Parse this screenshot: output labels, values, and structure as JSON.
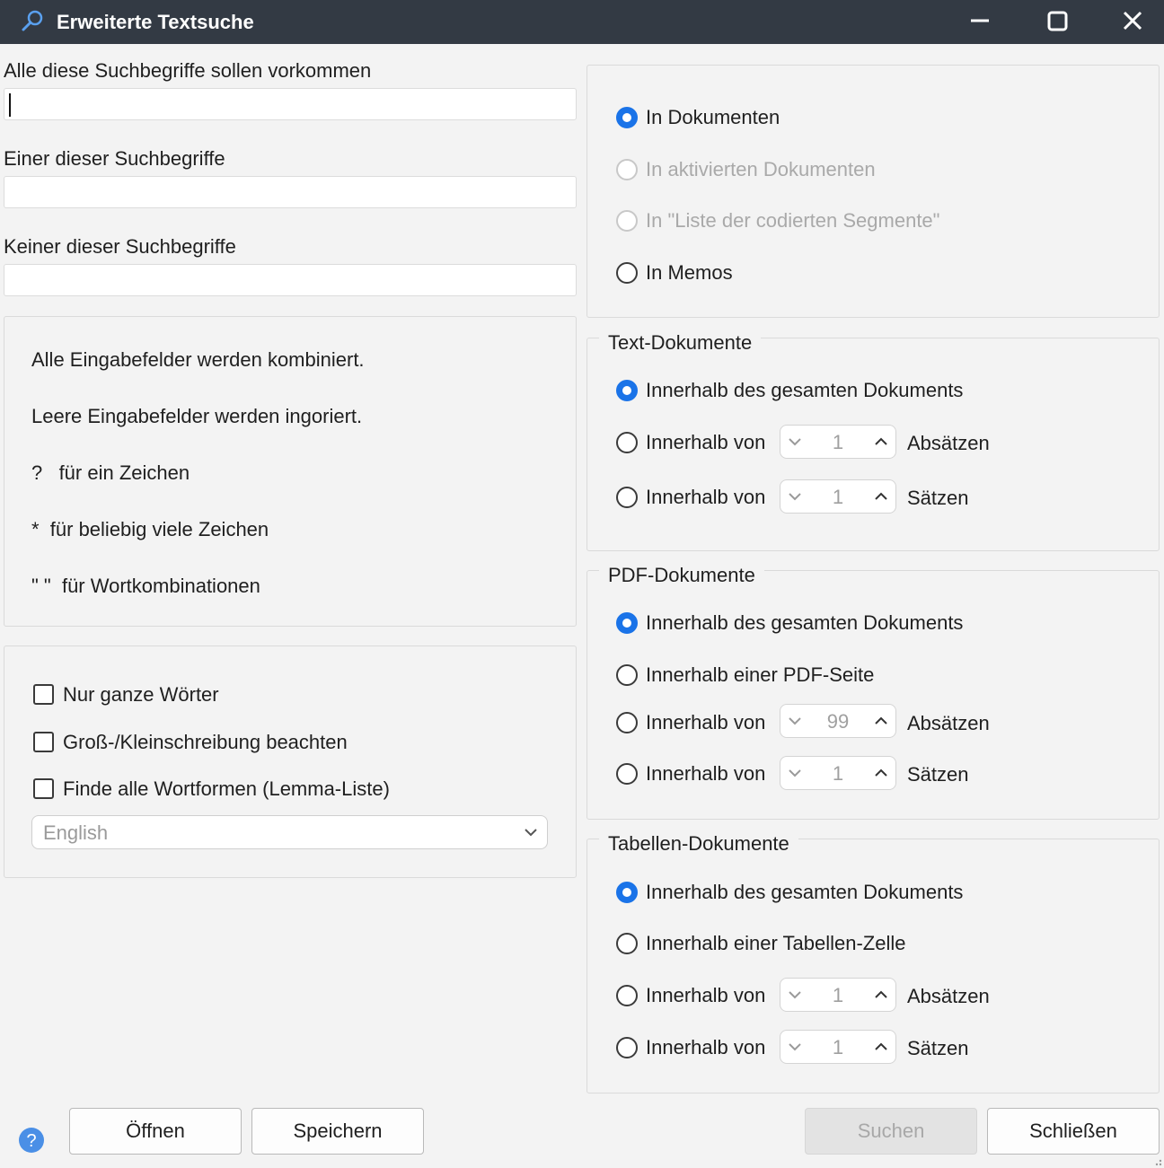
{
  "window": {
    "title": "Erweiterte Textsuche"
  },
  "colors": {
    "titlebar": "#333a44",
    "accent": "#1a73e8",
    "background": "#f3f3f3"
  },
  "fields": {
    "all_label": "Alle diese Suchbegriffe sollen vorkommen",
    "all_value": "",
    "any_label": "Einer dieser Suchbegriffe",
    "any_value": "",
    "none_label": "Keiner dieser Suchbegriffe",
    "none_value": ""
  },
  "hints": {
    "combined": "Alle Eingabefelder werden kombiniert.",
    "ignored": "Leere Eingabefelder werden ingoriert.",
    "single_char": "?   für ein Zeichen",
    "many_chars": "*  für beliebig viele Zeichen",
    "word_combo": "\" \"  für Wortkombinationen"
  },
  "options": {
    "whole_words": "Nur ganze Wörter",
    "case_sensitive": "Groß-/Kleinschreibung beachten",
    "lemma": "Finde alle Wortformen (Lemma-Liste)",
    "language": "English"
  },
  "scope": {
    "in_documents": "In Dokumenten",
    "in_activated": "In aktivierten Dokumenten",
    "in_coded_segments": "In \"Liste der codierten Segmente\"",
    "in_memos": "In Memos",
    "selected": "in_documents"
  },
  "text_docs": {
    "title": "Text-Dokumente",
    "whole_doc": "Innerhalb des gesamten Dokuments",
    "within_label": "Innerhalb von",
    "paragraphs_value": "1",
    "paragraphs_unit": "Absätzen",
    "sentences_value": "1",
    "sentences_unit": "Sätzen"
  },
  "pdf_docs": {
    "title": "PDF-Dokumente",
    "whole_doc": "Innerhalb des gesamten Dokuments",
    "page": "Innerhalb einer PDF-Seite",
    "within_label": "Innerhalb von",
    "paragraphs_value": "99",
    "paragraphs_unit": "Absätzen",
    "sentences_value": "1",
    "sentences_unit": "Sätzen"
  },
  "table_docs": {
    "title": "Tabellen-Dokumente",
    "whole_doc": "Innerhalb des gesamten Dokuments",
    "cell": "Innerhalb einer Tabellen-Zelle",
    "within_label": "Innerhalb von",
    "paragraphs_value": "1",
    "paragraphs_unit": "Absätzen",
    "sentences_value": "1",
    "sentences_unit": "Sätzen"
  },
  "buttons": {
    "open": "Öffnen",
    "save": "Speichern",
    "search": "Suchen",
    "close": "Schließen"
  },
  "help": {
    "glyph": "?"
  }
}
